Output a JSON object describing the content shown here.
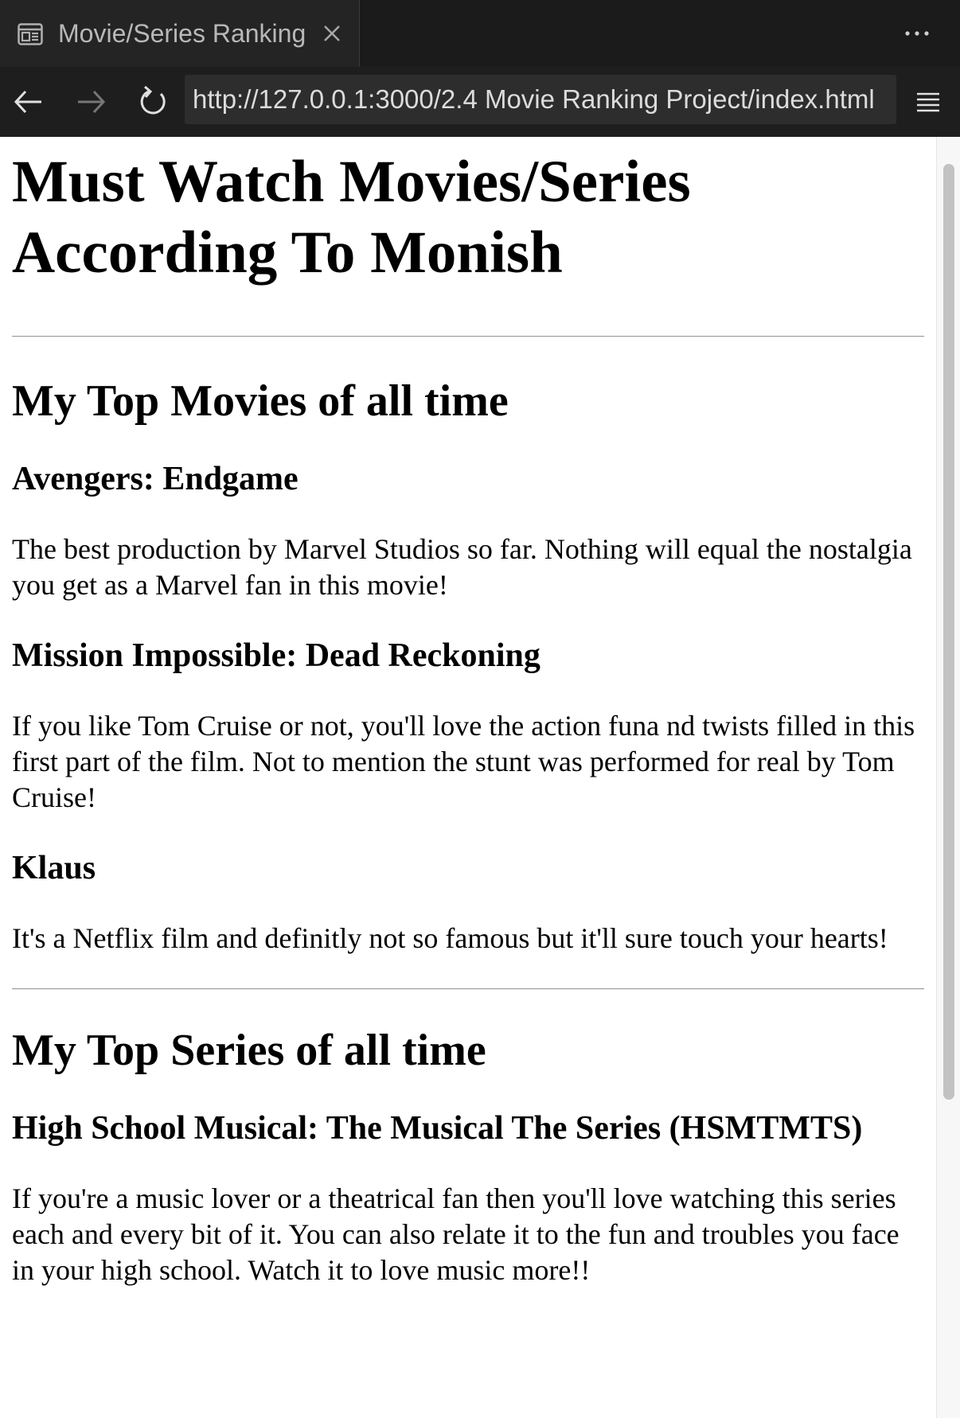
{
  "browser": {
    "tab_title": "Movie/Series Ranking",
    "url": "http://127.0.0.1:3000/2.4 Movie Ranking Project/index.html",
    "icons": {
      "tab": "page-icon",
      "close": "close-icon",
      "more": "more-icon",
      "back": "back-arrow-icon",
      "forward": "forward-arrow-icon",
      "reload": "reload-icon",
      "menu": "menu-icon"
    }
  },
  "page": {
    "title": "Must Watch Movies/Series According To Monish",
    "movies": {
      "heading": "My Top Movies of all time",
      "items": [
        {
          "title": "Avengers: Endgame",
          "description": "The best production by Marvel Studios so far. Nothing will equal the nostalgia you get as a Marvel fan in this movie!"
        },
        {
          "title": "Mission Impossible: Dead Reckoning",
          "description": "If you like Tom Cruise or not, you'll love the action funa nd twists filled in this first part of the film. Not to mention the stunt was performed for real by Tom Cruise!"
        },
        {
          "title": "Klaus",
          "description": "It's a Netflix film and definitly not so famous but it'll sure touch your hearts!"
        }
      ]
    },
    "series": {
      "heading": "My Top Series of all time",
      "items": [
        {
          "title": "High School Musical: The Musical The Series (HSMTMTS)",
          "description": "If you're a music lover or a theatrical fan then you'll love watching this series each and every bit of it. You can also relate it to the fun and troubles you face in your high school. Watch it to love music more!!"
        }
      ]
    }
  }
}
